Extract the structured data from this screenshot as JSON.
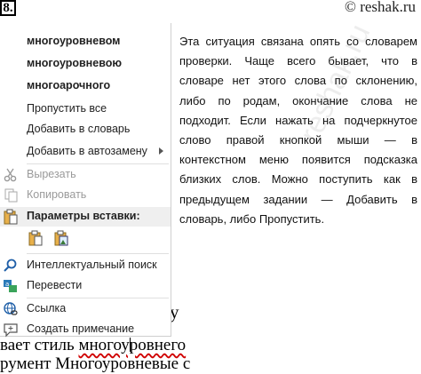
{
  "exercise_number": "8.",
  "site": "© reshak.ru",
  "watermark": "reshak.ru",
  "menu": {
    "suggestions": [
      "многоуровневом",
      "многоуровневою",
      "многоарочного"
    ],
    "ignore_all": "Пропустить все",
    "add_to_dictionary": "Добавить в словарь",
    "add_to_autocorrect": "Добавить в автозамену",
    "cut": "Вырезать",
    "copy": "Копировать",
    "paste_options": "Параметры вставки:",
    "smart_lookup": "Интеллектуальный поиск",
    "translate": "Перевести",
    "link": "Ссылка",
    "new_comment": "Создать примечание"
  },
  "document": {
    "char_y": "у",
    "line1": "вает стиль многоуровнего",
    "line2": "румент Многоуровневые с"
  },
  "paragraph": "Эта ситуация связана опять со словарем проверки. Чаще всего бывает, что в словаре нет этого слова по склонению, либо по родам, окончание слова не подходит. Если нажать на подчеркнутое слово правой кнопкой мыши — в контекстном меню появится подсказка близких слов. Можно поступить как в предыдущем задании — Добавить в словарь, либо Пропустить."
}
